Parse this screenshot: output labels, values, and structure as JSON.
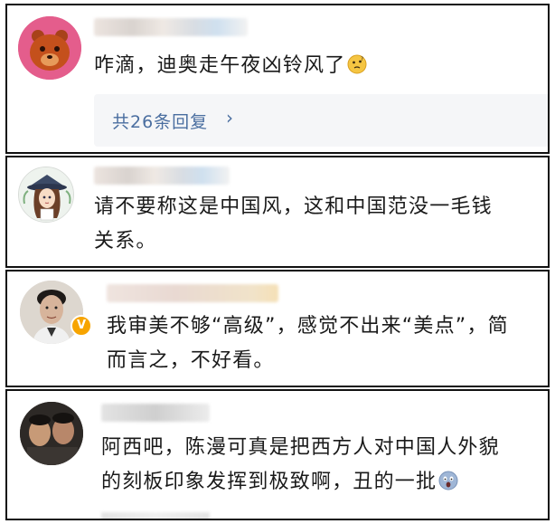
{
  "comments": [
    {
      "text": "咋滴，迪奥走午夜凶铃风了",
      "emoji": "thinking-face",
      "reply_count_label": "共26条回复"
    },
    {
      "line1": "请不要称这是中国风，这和中国范没一毛钱",
      "line2": "关系。"
    },
    {
      "line1": "我审美不够“高级”，感觉不出来“美点”，简",
      "line2": "而言之，不好看。",
      "verified": true
    },
    {
      "line1": "阿西吧，陈漫可真是把西方人对中国人外貌",
      "line2": "的刻板印象发挥到极致啊，丑的一批",
      "emoji": "face-screaming-in-fear"
    }
  ],
  "colors": {
    "reply_link": "#4a6ea0",
    "verified_badge": "#f7a400",
    "avatar1_bg": "#e05886"
  },
  "icons": [
    "chevron-right-icon",
    "verified-badge-icon"
  ]
}
